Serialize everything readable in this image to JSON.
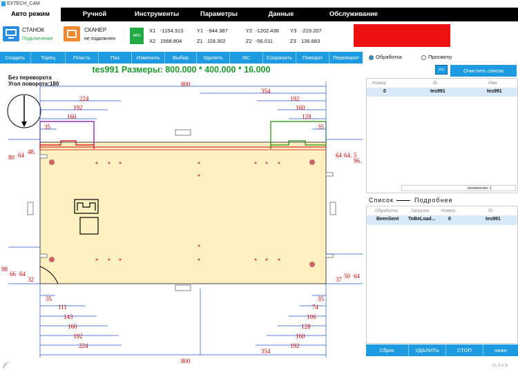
{
  "window": {
    "title": "EXTECH_CAM",
    "version": "v1.3.0 b"
  },
  "menu": [
    "Авто режим",
    "Ручной",
    "Инструменты",
    "Параметры",
    "Данные",
    "Обслуживание"
  ],
  "machine": {
    "label": "СТАНОК",
    "status": "Подключение"
  },
  "scanner": {
    "label": "СКАНЕР",
    "status": "не подключен"
  },
  "abs_badge": "ABS",
  "coords": {
    "x1_label": "X1",
    "x1": "-1154.313",
    "y1_label": "Y1",
    "y1": "-944.387",
    "y2_label": "Y2",
    "y2": "-1202.438",
    "y3_label": "Y3",
    "y3": "-219.207",
    "x2_label": "X2",
    "x2": "1568.804",
    "z1_label": "Z1",
    "z1": "118.302",
    "z2_label": "Z2",
    "z2": "-56.011",
    "z3_label": "Z3",
    "z3": "136.683"
  },
  "colors": {
    "accent": "#1e9be0",
    "alarm": "#ee1111",
    "machine_icon": "#2a8ee0",
    "scanner_icon": "#f08a30",
    "abs": "#22aa44",
    "part_fill": "#fdf0c0",
    "dim": "#cc0000",
    "title_green": "#1a9a2a"
  },
  "toolbar": [
    "Создать",
    "Торец",
    "Пласть",
    "Паз",
    "Изменить",
    "Выбор",
    "Удалить",
    "NC",
    "Сохранить",
    "Поворот",
    "Переворот"
  ],
  "part": {
    "title": "tes991  Размеры: 800.000 * 400.000 * 16.000",
    "info_line1": "Без переворота",
    "info_line2": "Угол поворота:180"
  },
  "dims": {
    "top_800": "800",
    "top_354": "354",
    "top_224": "224",
    "top_192l": "192",
    "top_192r": "192",
    "top_160l": "160",
    "top_160r": "160",
    "top_128": "128",
    "top_35l": "35",
    "top_35r": "35",
    "left_80": "80",
    "left_64": "64",
    "left_48": "48.",
    "right_64": "64",
    "right_64b": "64.",
    "right_5": "5",
    "right_96": "96.",
    "left_98": "98",
    "left_66": "66",
    "left_64b": "64",
    "left_32": "32",
    "right_37": "37",
    "right_50": "50",
    "right_64c": "64",
    "bot_35l": "35",
    "bot_111": "111",
    "bot_143": "143",
    "bot_160l": "160",
    "bot_192l": "192",
    "bot_224": "224",
    "bot_35r": "35",
    "bot_74": "74",
    "bot_106": "106",
    "bot_128": "128",
    "bot_160r": "160",
    "bot_192r": "192",
    "bot_354": "354",
    "bot_800": "800"
  },
  "right_panel": {
    "radio_process": "Обработка",
    "radio_view": "Просмотр",
    "arrow_btn": ">>",
    "clear_btn": "Очистить список",
    "head_num": "Номер",
    "head_id": "ID",
    "head_name": "Имя",
    "row_num": "0",
    "row_id": "tes991",
    "row_name": "tes991",
    "count_label": "количество: 1",
    "list_tab": "Список",
    "detail_tab": "Подробнее",
    "h2_process": "Обработка",
    "h2_load": "Загрузка",
    "h2_num": "Номер",
    "h2_id": "ID",
    "r2_process": "BeenSent",
    "r2_load": "ToBeLoad...",
    "r2_num": "0",
    "r2_id": "tes991"
  },
  "bottom_buttons": [
    "Сброс",
    "УДАЛИТЬ",
    "СТОП",
    "нижн"
  ]
}
